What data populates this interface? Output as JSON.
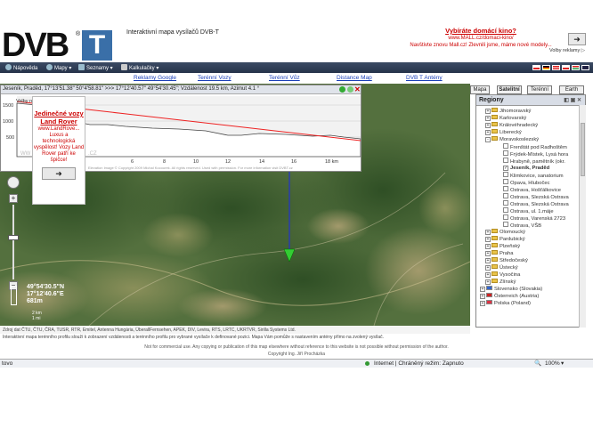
{
  "header": {
    "logo_text": "DVB",
    "logo_t": "T",
    "logo_reg": "®",
    "title": "Interaktivní mapa vysílačů DVB-T"
  },
  "ad_top": {
    "headline": "Vybíráte domácí kino?",
    "link": "www.MALL.cz/domaci-kino/",
    "text": "Navštivte znovu Mall.cz! Zlevnili jsme, máme nové modely...",
    "options": "Volby reklamy ▷"
  },
  "menu": {
    "items": [
      "Nápověda",
      "Mapy",
      "Seznamy",
      "Kalkulačky"
    ]
  },
  "links": [
    "Reklamy Google",
    "Terénní Vozy",
    "Terénní Vůz",
    "Distance Map",
    "DVB T Antény"
  ],
  "map_buttons": [
    "Mapa",
    "Satelitní",
    "Terénní",
    "Earth"
  ],
  "profile": {
    "header": "Jeseník, Praděd, 17°13'51.38\" 50°4'58.81\" >>> 17°12'40.57\" 49°54'30.45\"; Vzdálenost 19.5 km, Azimut 4.1 °",
    "y_ticks": [
      "1500",
      "1000",
      "500"
    ],
    "x_ticks": [
      "6",
      "8",
      "10",
      "12",
      "14",
      "16",
      "18 km"
    ],
    "copyright": "Elevation Image © Copyright 2009 Michal Kocourek. All rights reserved. Used with permission. For more information visit DVBT.cz",
    "watermark_left": "WW",
    "watermark_right": ".CZ"
  },
  "ad_left": {
    "options": "Volby reklamy ▷",
    "headline": "Jedinečné vozy Land Rover",
    "link": "www.LandRove...",
    "text": "Luxus a technologická vyspělost! Vozy Land Rover patří ke špičce!",
    "arrow": "➜"
  },
  "coords": {
    "lat": "49°54'30.5\"N",
    "lon": "17°12'40.6\"E",
    "alt": "681m"
  },
  "zoom_labels": [
    "2 km",
    "1 mi"
  ],
  "panel": {
    "title": "Regiony",
    "items": [
      {
        "t": "Jihomoravský",
        "lvl": 1,
        "type": "folder",
        "exp": "+"
      },
      {
        "t": "Karlovarský",
        "lvl": 1,
        "type": "folder",
        "exp": "+"
      },
      {
        "t": "Královéhradecký",
        "lvl": 1,
        "type": "folder",
        "exp": "+"
      },
      {
        "t": "Liberecký",
        "lvl": 1,
        "type": "folder",
        "exp": "+"
      },
      {
        "t": "Moravskoslezský",
        "lvl": 1,
        "type": "folder",
        "exp": "-"
      },
      {
        "t": "Frenštát pod Radhoštěm",
        "lvl": 2,
        "type": "check"
      },
      {
        "t": "Frýdek-Místek, Lysá hora",
        "lvl": 2,
        "type": "check"
      },
      {
        "t": "Hrabyně, pamětník (okr.",
        "lvl": 2,
        "type": "check"
      },
      {
        "t": "Jeseník, Praděd",
        "lvl": 2,
        "type": "check",
        "checked": true
      },
      {
        "t": "Klimkovice, sanatorium",
        "lvl": 2,
        "type": "check"
      },
      {
        "t": "Opava, Hlubočec",
        "lvl": 2,
        "type": "check"
      },
      {
        "t": "Ostrava, Hošťálkovice",
        "lvl": 2,
        "type": "check"
      },
      {
        "t": "Ostrava, Slezská Ostrava",
        "lvl": 2,
        "type": "check"
      },
      {
        "t": "Ostrava, Slezská Ostrava",
        "lvl": 2,
        "type": "check"
      },
      {
        "t": "Ostrava, ul. 1.máje",
        "lvl": 2,
        "type": "check"
      },
      {
        "t": "Ostrava, Varenská 2723",
        "lvl": 2,
        "type": "check"
      },
      {
        "t": "Ostrava, VŠB",
        "lvl": 2,
        "type": "check"
      },
      {
        "t": "Olomoucký",
        "lvl": 1,
        "type": "folder",
        "exp": "+"
      },
      {
        "t": "Pardubický",
        "lvl": 1,
        "type": "folder",
        "exp": "+"
      },
      {
        "t": "Plzeňský",
        "lvl": 1,
        "type": "folder",
        "exp": "+"
      },
      {
        "t": "Praha",
        "lvl": 1,
        "type": "folder",
        "exp": "+"
      },
      {
        "t": "Středočeský",
        "lvl": 1,
        "type": "folder",
        "exp": "+"
      },
      {
        "t": "Ústecký",
        "lvl": 1,
        "type": "folder",
        "exp": "+"
      },
      {
        "t": "Vysočina",
        "lvl": 1,
        "type": "folder",
        "exp": "+"
      },
      {
        "t": "Zlínský",
        "lvl": 1,
        "type": "folder",
        "exp": "+"
      },
      {
        "t": "Slovensko (Slovakia)",
        "lvl": 0,
        "type": "flag",
        "exp": "+",
        "flag": "#3366cc"
      },
      {
        "t": "Österreich (Austria)",
        "lvl": 0,
        "type": "flag",
        "exp": "+",
        "flag": "#cc2222"
      },
      {
        "t": "Polska (Poland)",
        "lvl": 0,
        "type": "flag",
        "exp": "+",
        "flag": "#dd3344"
      }
    ]
  },
  "footer": {
    "sources": "Zdroj dat ČTU, ČTU, ČRA, TUSR, RTR, Emitel, Antenna Hungária, ÜberallFernsehen, APEK, DIV, Levira, RTS, LRTC, UKRTVR, Sirilla Systems Ltd.",
    "info": "Interaktivní mapa terénního profilu slouží k zobrazení vzdálenosti a terénního profilu pro vybrané vysílače k definované pozici. Mapa Vám pomůže s nastavením antény přímo na zvolený vysílač.",
    "notice": "Not for commercial use. Any copying or publication of this map elsewhere without reference to this website is not possible without permission of the author.",
    "copyright": "Copyright Ing. Jiří Procházka"
  },
  "status": {
    "left": "tovo",
    "zone": "Internet | Chráněný režim: Zapnuto",
    "zoom": "100%"
  }
}
